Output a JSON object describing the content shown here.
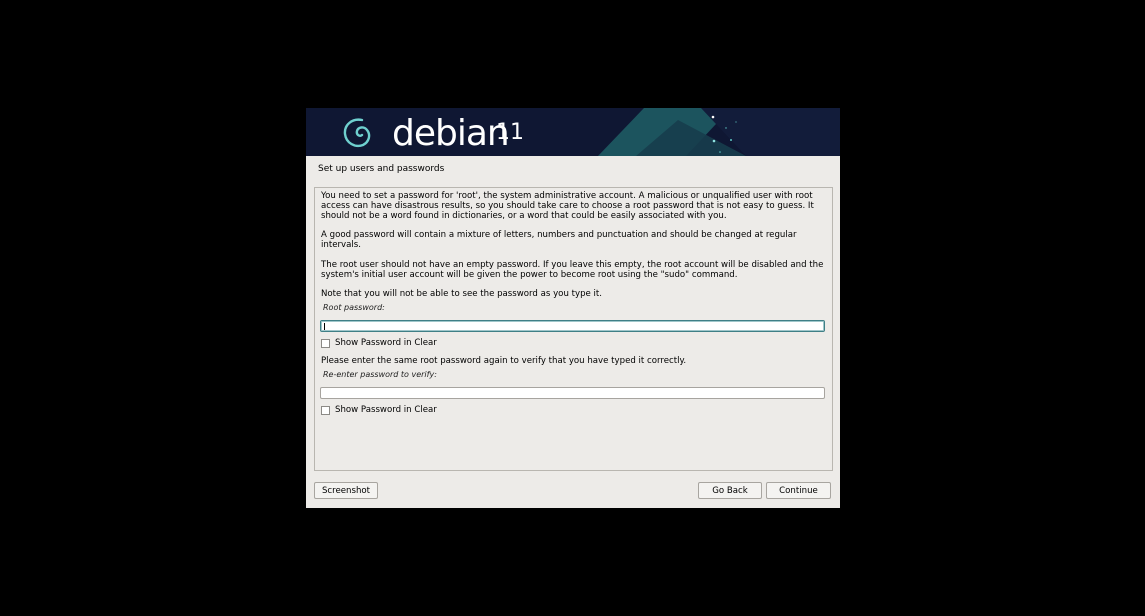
{
  "banner": {
    "logo_text": "debian",
    "version": "11"
  },
  "step_title": "Set up users and passwords",
  "paragraphs": {
    "p1": "You need to set a password for 'root', the system administrative account. A malicious or unqualified user with root access can have disastrous results, so you should take care to choose a root password that is not easy to guess. It should not be a word found in dictionaries, or a word that could be easily associated with you.",
    "p2": "A good password will contain a mixture of letters, numbers and punctuation and should be changed at regular intervals.",
    "p3": "The root user should not have an empty password. If you leave this empty, the root account will be disabled and the system's initial user account will be given the power to become root using the \"sudo\" command.",
    "p4": "Note that you will not be able to see the password as you type it.",
    "p5": "Please enter the same root password again to verify that you have typed it correctly."
  },
  "root_password": {
    "label": "Root password:",
    "value": "",
    "show_clear_label": "Show Password in Clear",
    "show_clear_checked": false
  },
  "verify_password": {
    "label": "Re-enter password to verify:",
    "value": "",
    "show_clear_label": "Show Password in Clear",
    "show_clear_checked": false
  },
  "buttons": {
    "screenshot": "Screenshot",
    "go_back": "Go Back",
    "continue": "Continue"
  },
  "colors": {
    "background": "#000000",
    "window": "#edebe8",
    "banner": "#0f1733",
    "focus_border": "#3f7f86"
  }
}
